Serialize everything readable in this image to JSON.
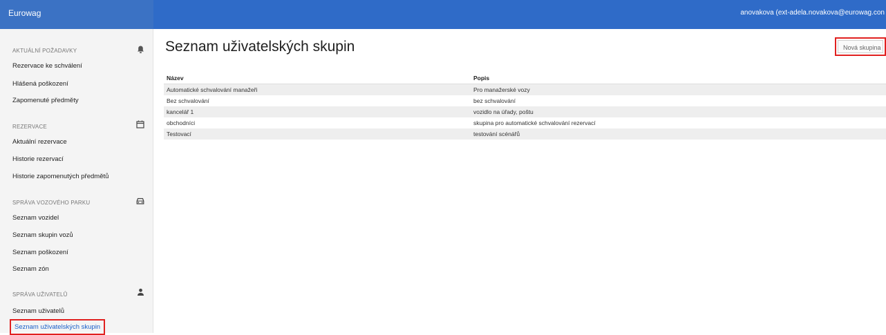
{
  "header": {
    "brand": "Eurowag",
    "user": "anovakova (ext-adela.novakova@eurowag.con"
  },
  "sidebar": {
    "sections": [
      {
        "title": "AKTUÁLNÍ POŽADAVKY",
        "icon": "bell-icon",
        "items": [
          "Rezervace ke schválení",
          "Hlášená poškození",
          "Zapomenuté předměty"
        ]
      },
      {
        "title": "REZERVACE",
        "icon": "calendar-icon",
        "items": [
          "Aktuální rezervace",
          "Historie rezervací",
          "Historie zapomenutých předmětů"
        ]
      },
      {
        "title": "SPRÁVA VOZOVÉHO PARKU",
        "icon": "car-icon",
        "items": [
          "Seznam vozidel",
          "Seznam skupin vozů",
          "Seznam poškození",
          "Seznam zón"
        ]
      },
      {
        "title": "SPRÁVA UŽIVATELŮ",
        "icon": "user-icon",
        "items": [
          "Seznam uživatelů",
          "Seznam uživatelských skupin"
        ]
      }
    ]
  },
  "main": {
    "title": "Seznam uživatelských skupin",
    "new_button": "Nová skupina",
    "table": {
      "headers": [
        "Název",
        "Popis"
      ],
      "rows": [
        [
          "Automatické schvalování manažeři",
          "Pro manažerské vozy"
        ],
        [
          "Bez schvalování",
          "bez schvalování"
        ],
        [
          "kancelář 1",
          "vozidlo na úřady, poštu"
        ],
        [
          "obchodníci",
          "skupina pro automatické schvalování rezervací"
        ],
        [
          "Testovací",
          "testování scénářů"
        ]
      ]
    }
  },
  "colors": {
    "header_bg": "#2f6bc8",
    "highlight": "#e0201f",
    "active_link": "#1a5fc9"
  }
}
